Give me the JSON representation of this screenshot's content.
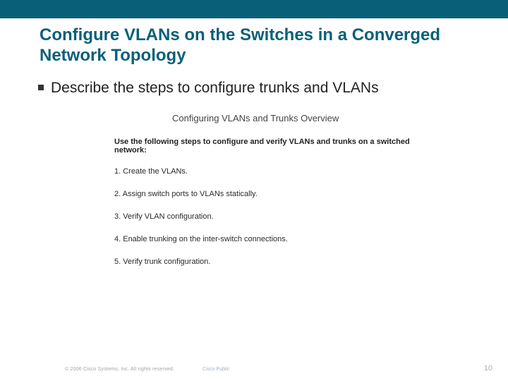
{
  "header_bar": {},
  "title": "Configure VLANs on the Switches in a Converged Network Topology",
  "bullet": {
    "text": "Describe the steps to configure trunks and VLANs"
  },
  "overview": {
    "title": "Configuring VLANs and Trunks Overview",
    "intro": "Use the following steps to configure and verify VLANs and trunks on a switched network:",
    "steps": [
      "1. Create the VLANs.",
      "2. Assign switch ports to VLANs statically.",
      "3. Verify VLAN configuration.",
      "4. Enable trunking on the inter-switch connections.",
      "5. Verify trunk configuration."
    ]
  },
  "footer": {
    "copyright": "© 2006 Cisco Systems, Inc. All rights reserved.",
    "label": "Cisco Public",
    "page": "10"
  }
}
